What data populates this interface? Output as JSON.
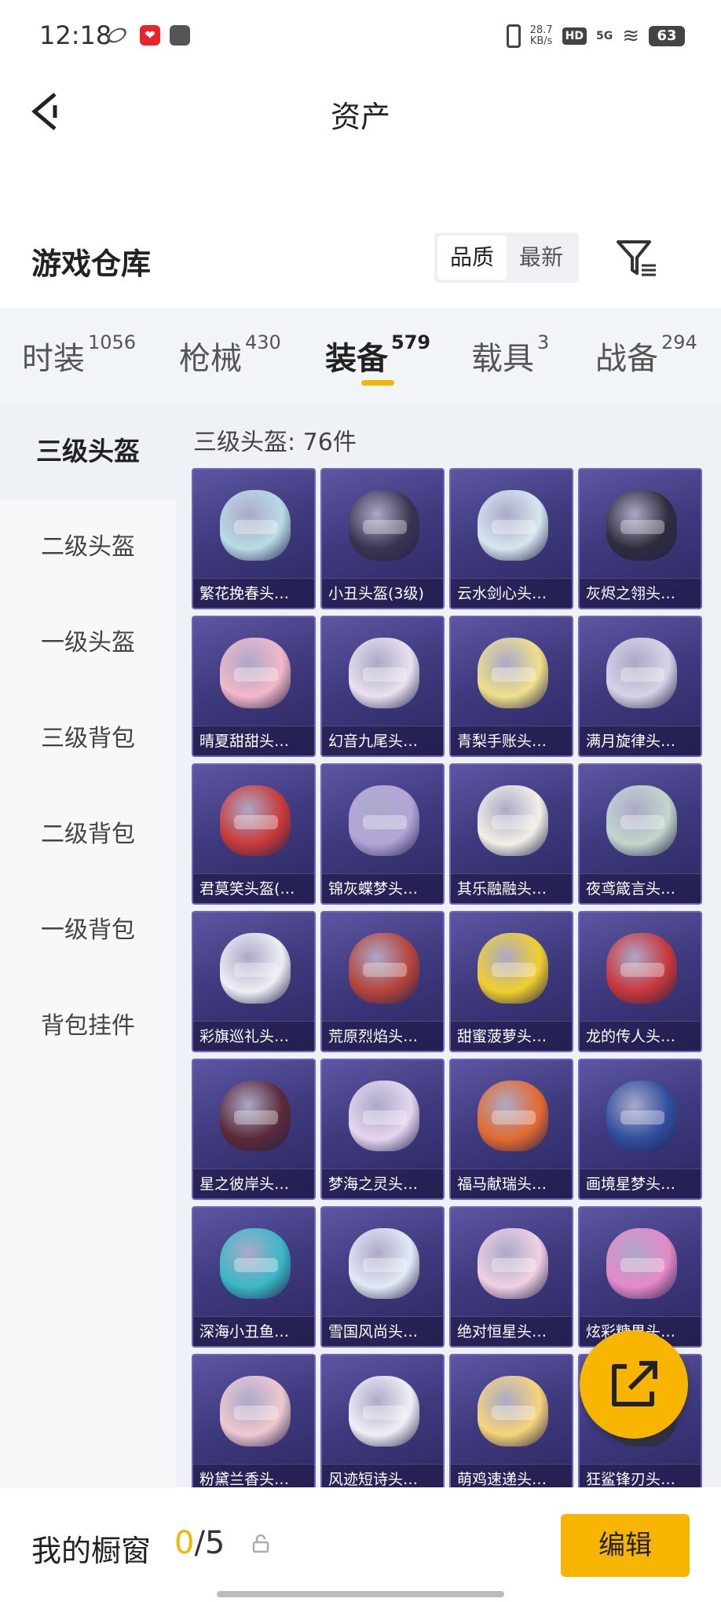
{
  "status": {
    "time": "12:18",
    "netspeed_value": "28.7",
    "netspeed_unit": "KB/s",
    "hd": "HD",
    "network": "5G",
    "battery": "63"
  },
  "header": {
    "title": "资产"
  },
  "warehouse": {
    "title": "游戏仓库",
    "sort_options": [
      "品质",
      "最新"
    ],
    "sort_active": "品质"
  },
  "tabs": [
    {
      "label": "时装",
      "count": "1056"
    },
    {
      "label": "枪械",
      "count": "430"
    },
    {
      "label": "装备",
      "count": "579",
      "active": true
    },
    {
      "label": "载具",
      "count": "3"
    },
    {
      "label": "战备",
      "count": "294"
    }
  ],
  "side_nav": [
    "三级头盔",
    "二级头盔",
    "一级头盔",
    "三级背包",
    "二级背包",
    "一级背包",
    "背包挂件"
  ],
  "grid": {
    "title": "三级头盔: 76件",
    "items": [
      {
        "label": "繁花挽春头…",
        "color": "#b8dbe6"
      },
      {
        "label": "小丑头盔(3级)",
        "color": "#3a3450"
      },
      {
        "label": "云水剑心头…",
        "color": "#d6e6ef"
      },
      {
        "label": "灰烬之翎头…",
        "color": "#2c2c3c"
      },
      {
        "label": "晴夏甜甜头…",
        "color": "#f2b8c8"
      },
      {
        "label": "幻音九尾头…",
        "color": "#e9e1ee"
      },
      {
        "label": "青梨手账头…",
        "color": "#f0e08a"
      },
      {
        "label": "满月旋律头…",
        "color": "#d7d3e6"
      },
      {
        "label": "君莫笑头盔(…",
        "color": "#c83a38"
      },
      {
        "label": "锦灰蝶梦头…",
        "color": "#b4a6d8"
      },
      {
        "label": "其乐融融头…",
        "color": "#f2efe6"
      },
      {
        "label": "夜鸢箴言头…",
        "color": "#c2d6cc"
      },
      {
        "label": "彩旗巡礼头…",
        "color": "#eeeef5"
      },
      {
        "label": "荒原烈焰头…",
        "color": "#b5443a"
      },
      {
        "label": "甜蜜菠萝头…",
        "color": "#f1cf2e"
      },
      {
        "label": "龙的传人头…",
        "color": "#c8373a"
      },
      {
        "label": "星之彼岸头…",
        "color": "#5a2a38"
      },
      {
        "label": "梦海之灵头…",
        "color": "#e4d6ef"
      },
      {
        "label": "福马献瑞头…",
        "color": "#e46a30"
      },
      {
        "label": "画境星梦头…",
        "color": "#2e4e9e"
      },
      {
        "label": "深海小丑鱼…",
        "color": "#3ab8c6"
      },
      {
        "label": "雪国风尚头…",
        "color": "#e3e9f5"
      },
      {
        "label": "绝对恒星头…",
        "color": "#f0d0e2"
      },
      {
        "label": "炫彩糖果头…",
        "color": "#e48ac8"
      },
      {
        "label": "粉黛兰香头…",
        "color": "#eec8d0"
      },
      {
        "label": "风迹短诗头…",
        "color": "#eef0f6"
      },
      {
        "label": "萌鸡速递头…",
        "color": "#f6d47a"
      },
      {
        "label": "狂鲨锋刃头…",
        "color": "#3c3c48"
      }
    ]
  },
  "bottom": {
    "window_label": "我的橱窗",
    "window_current": "0",
    "window_total": "/5",
    "edit_label": "编辑"
  },
  "colors": {
    "accent": "#f7b500"
  }
}
